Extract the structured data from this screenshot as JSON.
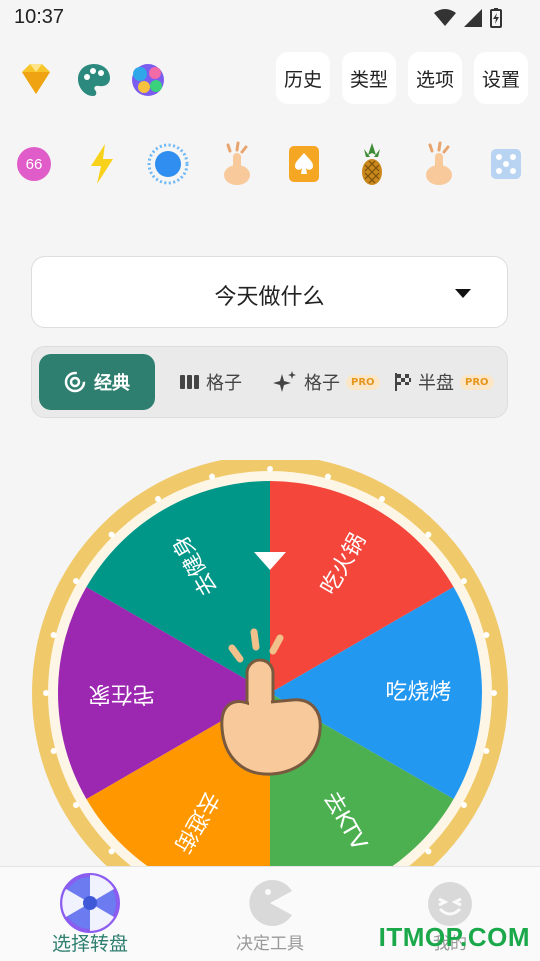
{
  "status": {
    "time": "10:37"
  },
  "header": {
    "buttons": {
      "history": "历史",
      "type": "类型",
      "options": "选项",
      "settings": "设置"
    }
  },
  "quick_row": {
    "badge_number": "66"
  },
  "wheel_title": "今天做什么",
  "modes": {
    "classic": "经典",
    "grid": "格子",
    "grid_pro": "格子",
    "half": "半盘",
    "pro_label": "PRO"
  },
  "wheel": {
    "segments": [
      {
        "label": "吃火锅",
        "color": "#f4463b"
      },
      {
        "label": "吃烧烤",
        "color": "#2398f0"
      },
      {
        "label": "去KTV",
        "color": "#4caf50"
      },
      {
        "label": "去逛街",
        "color": "#ff9800"
      },
      {
        "label": "宅在家",
        "color": "#9c27b0"
      },
      {
        "label": "去健身",
        "color": "#009688"
      }
    ],
    "rim_color": "#f0c96a"
  },
  "bottom_nav": {
    "items": [
      {
        "label": "选择转盘"
      },
      {
        "label": "决定工具"
      },
      {
        "label": "我的"
      }
    ]
  },
  "watermark": "ITMOP.COM"
}
